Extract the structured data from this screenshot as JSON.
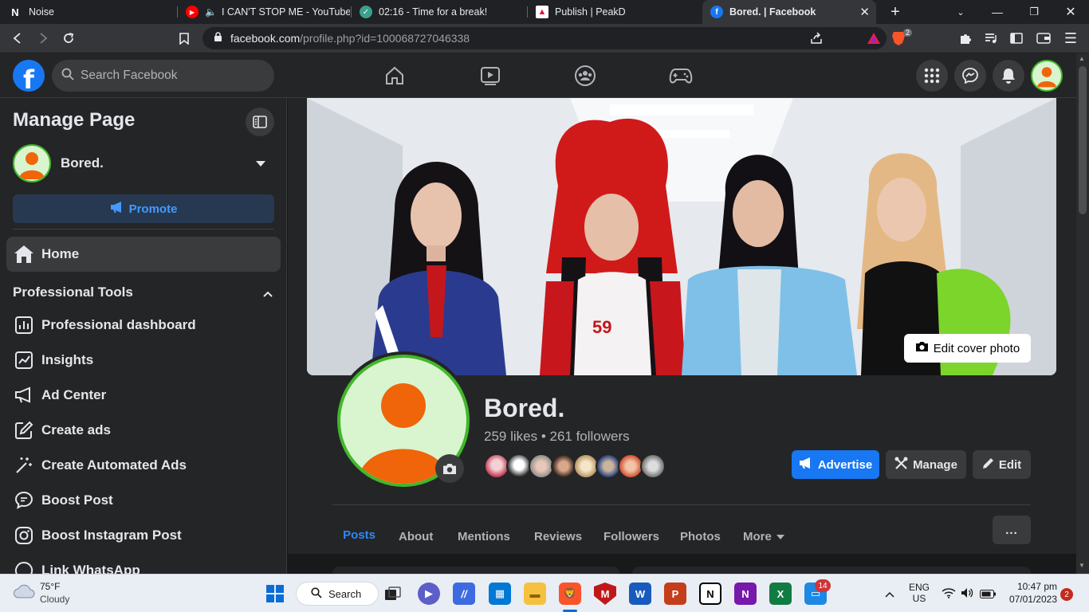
{
  "browser": {
    "tabs": [
      {
        "title": "Noise",
        "active": false,
        "icon": "notion-icon"
      },
      {
        "title": "I CAN'T STOP ME - YouTube M",
        "active": false,
        "icon": "youtube-icon",
        "audio": true
      },
      {
        "title": "02:16 - Time for a break!",
        "active": false,
        "icon": "check-circle-icon"
      },
      {
        "title": "Publish | PeakD",
        "active": false,
        "icon": "peakd-icon"
      },
      {
        "title": "Bored. | Facebook",
        "active": true,
        "icon": "facebook-icon"
      }
    ],
    "url_host": "facebook.com",
    "url_path": "/profile.php?id=100068727046338",
    "shield_badge": "2"
  },
  "fb": {
    "search_placeholder": "Search Facebook",
    "sidebar": {
      "title": "Manage Page",
      "page_name": "Bored.",
      "promote_label": "Promote",
      "home_label": "Home",
      "section_title": "Professional Tools",
      "tools": [
        {
          "label": "Professional dashboard",
          "icon": "dashboard-icon"
        },
        {
          "label": "Insights",
          "icon": "insights-icon"
        },
        {
          "label": "Ad Center",
          "icon": "megaphone-icon"
        },
        {
          "label": "Create ads",
          "icon": "pencil-square-icon"
        },
        {
          "label": "Create Automated Ads",
          "icon": "magic-wand-icon"
        },
        {
          "label": "Boost Post",
          "icon": "chat-bubble-icon"
        },
        {
          "label": "Boost Instagram Post",
          "icon": "instagram-icon"
        },
        {
          "label": "Link WhatsApp",
          "icon": "whatsapp-icon"
        }
      ]
    },
    "profile": {
      "name": "Bored.",
      "stats": "259 likes • 261 followers",
      "edit_cover_label": "Edit cover photo",
      "advertise_label": "Advertise",
      "manage_label": "Manage",
      "edit_label": "Edit",
      "tabs": [
        "Posts",
        "About",
        "Mentions",
        "Reviews",
        "Followers",
        "Photos",
        "More"
      ],
      "active_tab": "Posts",
      "more_menu": "..."
    },
    "colors": {
      "accent": "#1877f2",
      "avatar_ring": "#42b72a",
      "avatar_figure": "#f0640a",
      "avatar_bg": "#d8f5cf"
    }
  },
  "taskbar": {
    "weather_temp": "75°F",
    "weather_desc": "Cloudy",
    "search_label": "Search",
    "teams_badge": "14",
    "lang_top": "ENG",
    "lang_bottom": "US",
    "time": "10:47 pm",
    "date": "07/01/2023",
    "notif_count": "2"
  }
}
